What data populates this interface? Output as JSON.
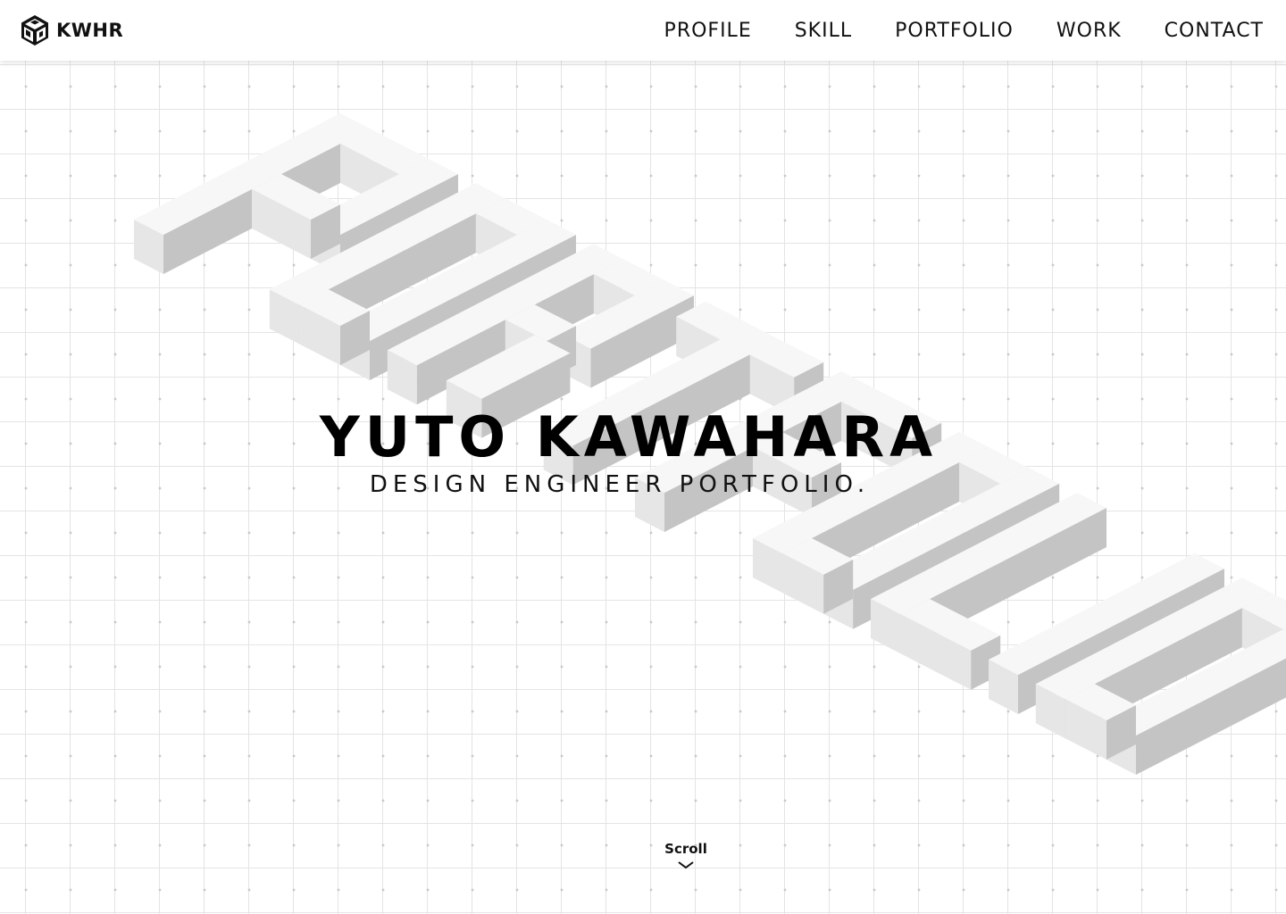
{
  "brand": {
    "logo_icon": "cube-logo-icon",
    "name": "KWHR"
  },
  "nav": {
    "items": [
      {
        "label": "PROFILE"
      },
      {
        "label": "SKILL"
      },
      {
        "label": "PORTFOLIO"
      },
      {
        "label": "WORK"
      },
      {
        "label": "CONTACT"
      }
    ]
  },
  "hero": {
    "title": "YUTO KAWAHARA",
    "subtitle": "DESIGN ENGINEER PORTFOLIO.",
    "background_art_icon": "isometric-3d-lettering"
  },
  "scroll": {
    "label": "Scroll",
    "icon": "chevron-down-icon"
  },
  "colors": {
    "background": "#ffffff",
    "grid_line": "#e4e4e4",
    "grid_dot": "#c9c9c9",
    "text": "#111111",
    "block_top": "#f7f7f7",
    "block_left": "#e6e6e6",
    "block_right": "#c4c4c4"
  }
}
